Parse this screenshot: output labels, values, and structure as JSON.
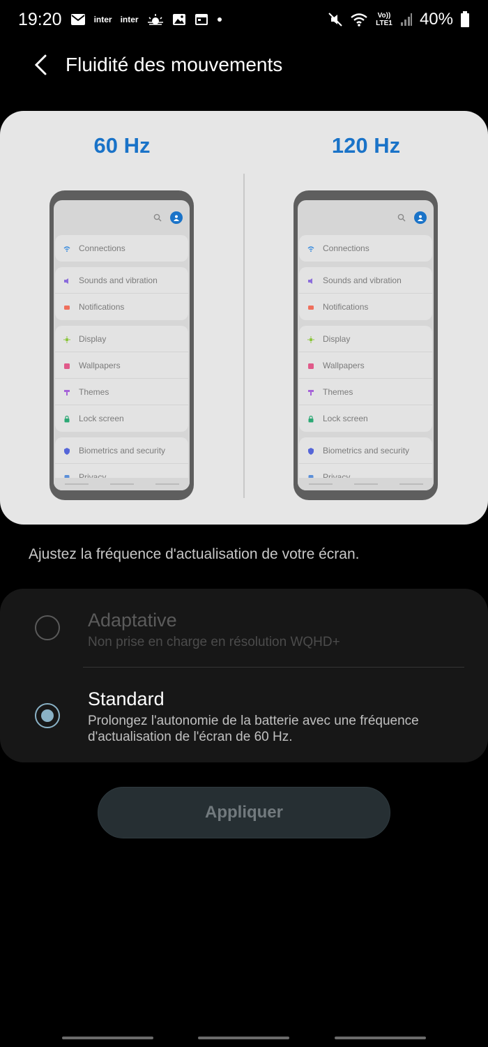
{
  "status_bar": {
    "time": "19:20",
    "carrier_1": "inter",
    "carrier_2": "inter",
    "network": "Vo)) LTE1",
    "battery": "40%",
    "icons": [
      "mail-icon",
      "weather-icon",
      "image-icon",
      "calendar-icon",
      "dot-icon",
      "mute-icon",
      "wifi-icon",
      "signal-icon",
      "battery-icon"
    ]
  },
  "header": {
    "title": "Fluidité des mouvements"
  },
  "preview": {
    "left_label": "60 Hz",
    "right_label": "120 Hz",
    "menu_groups": [
      [
        {
          "label": "Connections",
          "icon": "wifi-icon",
          "color": "#3e8ede"
        }
      ],
      [
        {
          "label": "Sounds and vibration",
          "icon": "speaker-icon",
          "color": "#8b6cdb"
        },
        {
          "label": "Notifications",
          "icon": "notification-icon",
          "color": "#ef6f5c"
        }
      ],
      [
        {
          "label": "Display",
          "icon": "sun-icon",
          "color": "#8cc63e"
        },
        {
          "label": "Wallpapers",
          "icon": "wallpaper-icon",
          "color": "#e05a8a"
        },
        {
          "label": "Themes",
          "icon": "brush-icon",
          "color": "#a563d8"
        },
        {
          "label": "Lock screen",
          "icon": "lock-icon",
          "color": "#2ba874"
        }
      ],
      [
        {
          "label": "Biometrics and security",
          "icon": "shield-icon",
          "color": "#5566d8"
        },
        {
          "label": "Privacy",
          "icon": "privacy-icon",
          "color": "#5b8fd8"
        }
      ]
    ]
  },
  "description": "Ajustez la fréquence d'actualisation de votre écran.",
  "options": {
    "adaptive": {
      "title": "Adaptative",
      "subtitle": "Non prise en charge en résolution WQHD+"
    },
    "standard": {
      "title": "Standard",
      "subtitle": "Prolongez l'autonomie de la batterie avec une fréquence d'actualisation de l'écran de 60 Hz."
    }
  },
  "apply_button": "Appliquer",
  "colors": {
    "accent": "#1a73c8",
    "radio_selected": "#8ab2c6"
  }
}
